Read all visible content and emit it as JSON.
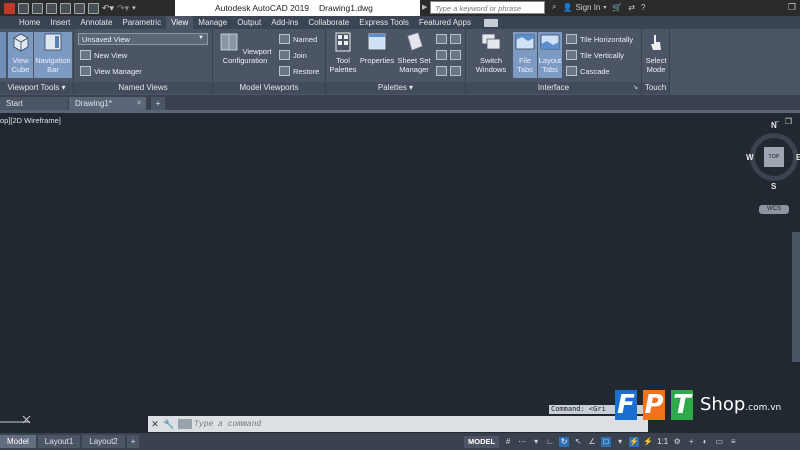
{
  "titlebar": {
    "app_title": "Autodesk AutoCAD 2019",
    "doc_title": "Drawing1.dwg",
    "search_placeholder": "Type a keyword or phrase",
    "signin_label": "Sign In"
  },
  "ribbon_tabs": [
    "Home",
    "Insert",
    "Annotate",
    "Parametric",
    "View",
    "Manage",
    "Output",
    "Add-ins",
    "Collaborate",
    "Express Tools",
    "Featured Apps"
  ],
  "active_tab": "View",
  "panels": {
    "viewport_tools": {
      "label": "Viewport Tools",
      "view_cube": "View Cube",
      "navigation_bar": "Navigation Bar"
    },
    "named_views": {
      "label": "Named Views",
      "dropdown_value": "Unsaved View",
      "new_view": "New View",
      "view_manager": "View Manager"
    },
    "model_viewports": {
      "label": "Model Viewports",
      "viewport_configuration": "Viewport Configuration",
      "named": "Named",
      "join": "Join",
      "restore": "Restore"
    },
    "palettes": {
      "label": "Palettes",
      "tool_palettes": "Tool Palettes",
      "properties": "Properties",
      "sheet_set_manager": "Sheet Set Manager"
    },
    "interface": {
      "label": "Interface",
      "switch_windows": "Switch Windows",
      "file_tabs": "File Tabs",
      "layout_tabs": "Layout Tabs",
      "tile_horizontally": "Tile Horizontally",
      "tile_vertically": "Tile Vertically",
      "cascade": "Cascade"
    },
    "touch": {
      "label": "Touch",
      "select_mode": "Select Mode"
    }
  },
  "file_tabs": {
    "start": "Start",
    "drawing": "Drawing1*"
  },
  "viewport": {
    "label": "op][2D Wireframe]",
    "cube_face": "TOP",
    "north": "N",
    "south": "S",
    "east": "E",
    "west": "W",
    "wcs": "WCS"
  },
  "command": {
    "history": "Command: <Gri",
    "placeholder": "Type a command"
  },
  "layout_tabs": [
    "Model",
    "Layout1",
    "Layout2"
  ],
  "status": {
    "model": "MODEL",
    "scale": "1:1"
  },
  "watermark": {
    "f": "F",
    "p": "P",
    "t": "T",
    "shop": "Shop",
    "domain": ".com.vn"
  },
  "colors": {
    "ribbon_bg": "#4b5566",
    "canvas_bg": "#212830",
    "fpt_blue": "#1a6fd1",
    "fpt_orange": "#f2711c",
    "fpt_green": "#2eaa4b"
  }
}
